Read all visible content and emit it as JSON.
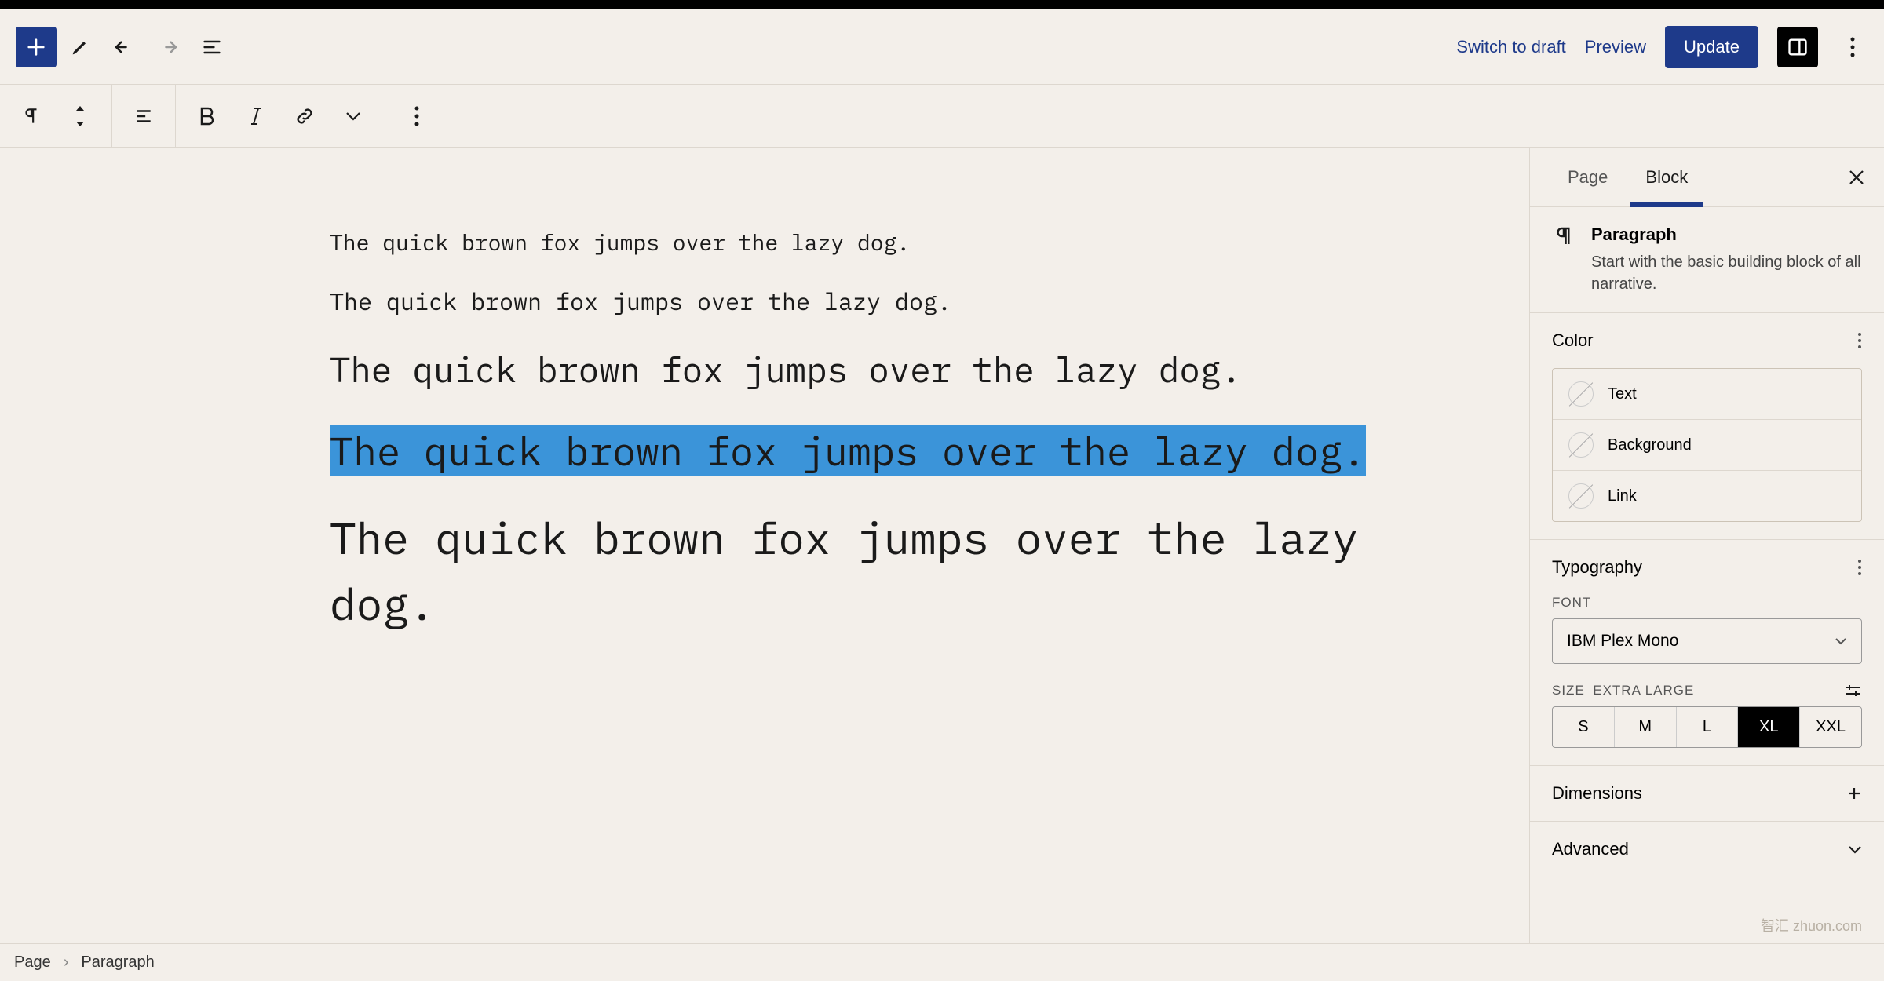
{
  "header": {
    "switch_draft": "Switch to draft",
    "preview": "Preview",
    "update": "Update"
  },
  "sidebar": {
    "tabs": {
      "page": "Page",
      "block": "Block"
    },
    "block_info": {
      "title": "Paragraph",
      "desc": "Start with the basic building block of all narrative."
    },
    "color_section": {
      "title": "Color",
      "text": "Text",
      "background": "Background",
      "link": "Link"
    },
    "typo_section": {
      "title": "Typography",
      "font_label": "FONT",
      "font_value": "IBM Plex Mono",
      "size_label": "SIZE",
      "size_value_label": "EXTRA LARGE",
      "sizes": [
        "S",
        "M",
        "L",
        "XL",
        "XXL"
      ],
      "active_size": "XL"
    },
    "dimensions": "Dimensions",
    "advanced": "Advanced"
  },
  "canvas": {
    "p1": "The quick brown fox jumps over the lazy dog.",
    "p2": "The quick brown fox jumps over the lazy dog.",
    "p3": "The quick brown fox jumps over the lazy dog.",
    "p4": "The quick brown fox jumps over the lazy dog.",
    "p5": "The quick brown fox jumps over the lazy dog."
  },
  "breadcrumb": {
    "root": "Page",
    "current": "Paragraph"
  },
  "watermark": "智汇 zhuon.com"
}
